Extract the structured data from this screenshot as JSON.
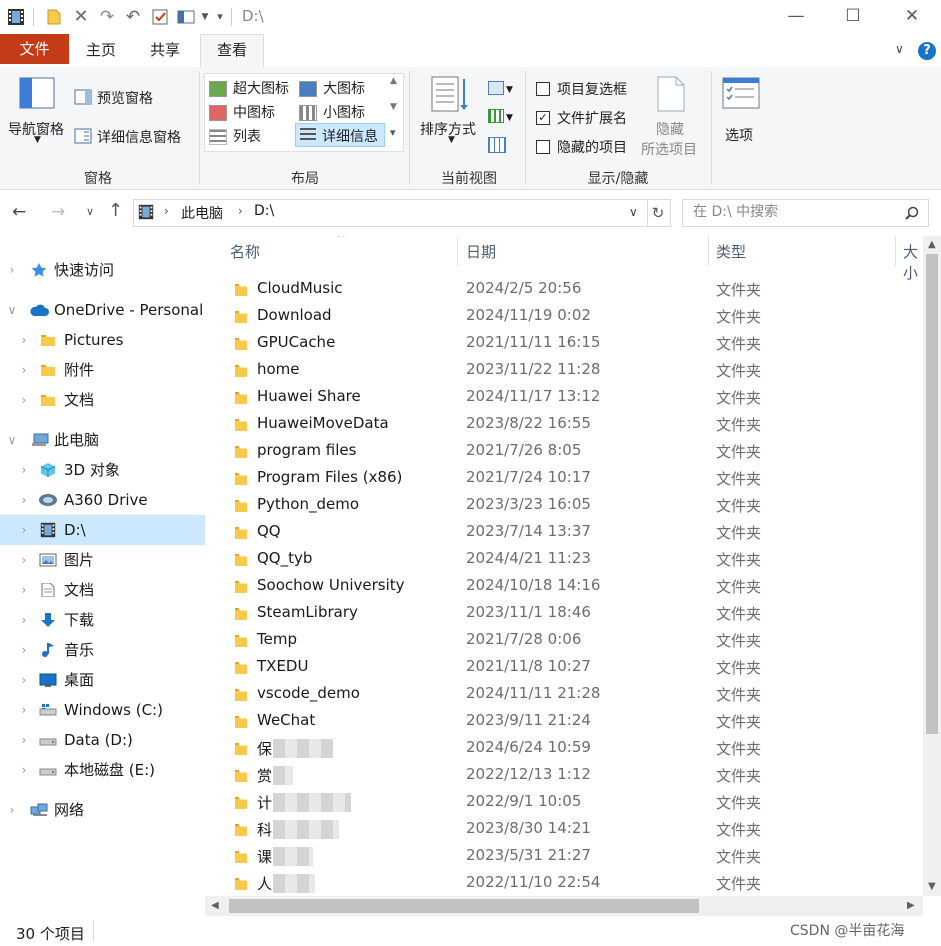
{
  "window": {
    "title": "D:\\",
    "controls": [
      "minimize-icon",
      "maximize-icon",
      "close-icon"
    ]
  },
  "ribbon_tabs": [
    {
      "label": "文件",
      "active": false
    },
    {
      "label": "主页",
      "active": false
    },
    {
      "label": "共享",
      "active": false
    },
    {
      "label": "查看",
      "active": true
    }
  ],
  "ribbon": {
    "panes": {
      "label": "窗格",
      "nav_pane": "导航窗格",
      "preview_pane": "预览窗格",
      "details_pane": "详细信息窗格"
    },
    "layout": {
      "label": "布局",
      "options": [
        "超大图标",
        "大图标",
        "中图标",
        "小图标",
        "列表",
        "详细信息"
      ],
      "selected": "详细信息"
    },
    "current_view": {
      "label": "当前视图",
      "sort_by": "排序方式"
    },
    "show_hide": {
      "label": "显示/隐藏",
      "item_checkboxes": {
        "label": "项目复选框",
        "checked": false
      },
      "file_extensions": {
        "label": "文件扩展名",
        "checked": true
      },
      "hidden_items": {
        "label": "隐藏的项目",
        "checked": false
      },
      "hide_selected_line1": "隐藏",
      "hide_selected_line2": "所选项目"
    },
    "options": "选项"
  },
  "address": {
    "crumbs": [
      "此电脑",
      "D:\\"
    ],
    "search_placeholder": "在 D:\\ 中搜索"
  },
  "sidebar": {
    "items": [
      {
        "label": "快速访问",
        "icon": "star-icon",
        "level": 0
      },
      {
        "label": "OneDrive - Personal",
        "icon": "cloud-icon",
        "level": 0
      },
      {
        "label": "Pictures",
        "icon": "folder-icon",
        "level": 1
      },
      {
        "label": "附件",
        "icon": "folder-icon",
        "level": 1
      },
      {
        "label": "文档",
        "icon": "folder-icon",
        "level": 1
      },
      {
        "label": "此电脑",
        "icon": "computer-icon",
        "level": 0
      },
      {
        "label": "3D 对象",
        "icon": "cube-icon",
        "level": 1
      },
      {
        "label": "A360 Drive",
        "icon": "a360-icon",
        "level": 1
      },
      {
        "label": "D:\\",
        "icon": "film-icon",
        "level": 1,
        "selected": true
      },
      {
        "label": "图片",
        "icon": "picture-icon",
        "level": 1
      },
      {
        "label": "文档",
        "icon": "document-icon",
        "level": 1
      },
      {
        "label": "下载",
        "icon": "download-icon",
        "level": 1
      },
      {
        "label": "音乐",
        "icon": "music-icon",
        "level": 1
      },
      {
        "label": "桌面",
        "icon": "desktop-icon",
        "level": 1
      },
      {
        "label": "Windows (C:)",
        "icon": "drive-icon",
        "level": 1
      },
      {
        "label": "Data (D:)",
        "icon": "drive-icon",
        "level": 1
      },
      {
        "label": "本地磁盘 (E:)",
        "icon": "drive-icon",
        "level": 1
      },
      {
        "label": "网络",
        "icon": "network-icon",
        "level": 0
      }
    ]
  },
  "list": {
    "columns": [
      "名称",
      "日期",
      "类型",
      "大小"
    ],
    "rows": [
      {
        "name": "CloudMusic",
        "date": "2024/2/5 20:56",
        "type": "文件夹"
      },
      {
        "name": "Download",
        "date": "2024/11/19 0:02",
        "type": "文件夹"
      },
      {
        "name": "GPUCache",
        "date": "2021/11/11 16:15",
        "type": "文件夹"
      },
      {
        "name": "home",
        "date": "2023/11/22 11:28",
        "type": "文件夹"
      },
      {
        "name": "Huawei Share",
        "date": "2024/11/17 13:12",
        "type": "文件夹"
      },
      {
        "name": "HuaweiMoveData",
        "date": "2023/8/22 16:55",
        "type": "文件夹"
      },
      {
        "name": "program files",
        "date": "2021/7/26 8:05",
        "type": "文件夹"
      },
      {
        "name": "Program Files (x86)",
        "date": "2021/7/24 10:17",
        "type": "文件夹"
      },
      {
        "name": "Python_demo",
        "date": "2023/3/23 16:05",
        "type": "文件夹"
      },
      {
        "name": "QQ",
        "date": "2023/7/14 13:37",
        "type": "文件夹"
      },
      {
        "name": "QQ_tyb",
        "date": "2024/4/21 11:23",
        "type": "文件夹"
      },
      {
        "name": "Soochow University",
        "date": "2024/10/18 14:16",
        "type": "文件夹"
      },
      {
        "name": "SteamLibrary",
        "date": "2023/11/1 18:46",
        "type": "文件夹"
      },
      {
        "name": "Temp",
        "date": "2021/7/28 0:06",
        "type": "文件夹"
      },
      {
        "name": "TXEDU",
        "date": "2021/11/8 10:27",
        "type": "文件夹"
      },
      {
        "name": "vscode_demo",
        "date": "2024/11/11 21:28",
        "type": "文件夹"
      },
      {
        "name": "WeChat",
        "date": "2023/9/11 21:24",
        "type": "文件夹"
      },
      {
        "name": "保",
        "date": "2024/6/24 10:59",
        "type": "文件夹",
        "blurred": true
      },
      {
        "name": "赏",
        "date": "2022/12/13 1:12",
        "type": "文件夹",
        "blurred": true
      },
      {
        "name": "计",
        "date": "2022/9/1 10:05",
        "type": "文件夹",
        "blurred": true
      },
      {
        "name": "科",
        "date": "2023/8/30 14:21",
        "type": "文件夹",
        "blurred": true
      },
      {
        "name": "课",
        "date": "2023/5/31 21:27",
        "type": "文件夹",
        "blurred": true
      },
      {
        "name": "人",
        "date": "2022/11/10 22:54",
        "type": "文件夹",
        "blurred": true
      }
    ]
  },
  "status": {
    "count": "30 个项目",
    "watermark": "CSDN @半亩花海"
  },
  "colors": {
    "file_tab": "#c33b17",
    "selection": "#cce8ff",
    "folder": "#f8c94a",
    "header_text": "#4c607a"
  }
}
